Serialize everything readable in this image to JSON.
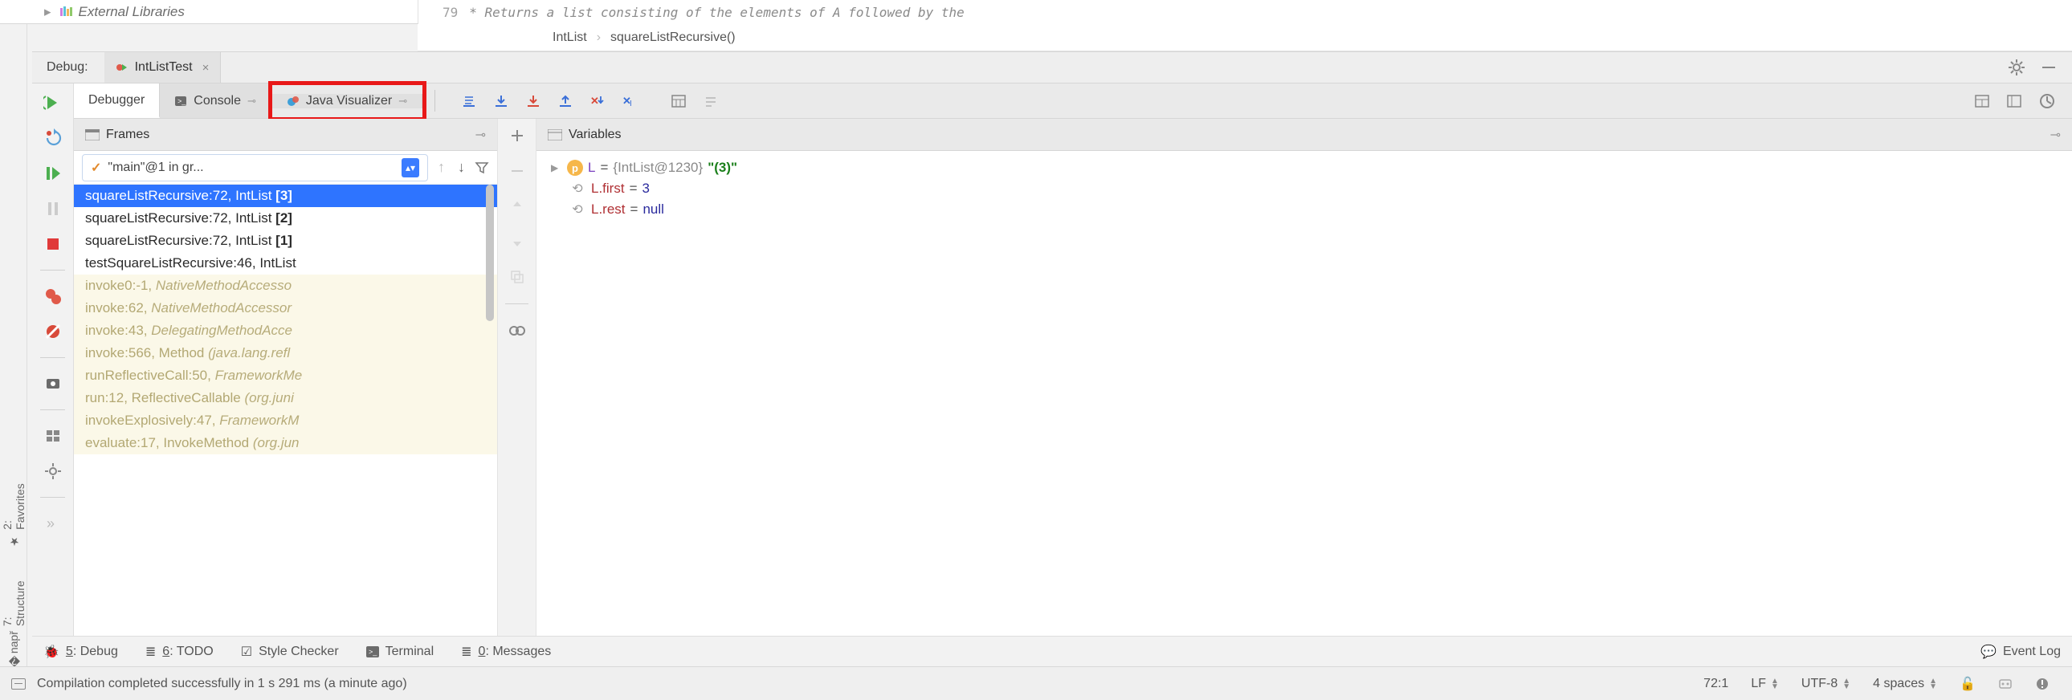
{
  "project": {
    "external_libs": "External Libraries"
  },
  "editor": {
    "line_no": "79",
    "comment": "* Returns a list consisting of the elements of A followed by the",
    "breadcrumb": [
      "IntList",
      "squareListRecursive()"
    ]
  },
  "debug": {
    "label": "Debug:",
    "run_config": "IntListTest",
    "tabs": {
      "debugger": "Debugger",
      "console": "Console",
      "java_vis": "Java Visualizer"
    }
  },
  "frames": {
    "title": "Frames",
    "thread": "\"main\"@1 in gr...",
    "stack": [
      {
        "text": "squareListRecursive:72, IntList ",
        "suffix": "[3]",
        "sel": true
      },
      {
        "text": "squareListRecursive:72, IntList ",
        "suffix": "[2]"
      },
      {
        "text": "squareListRecursive:72, IntList ",
        "suffix": "[1]"
      },
      {
        "text": "testSquareListRecursive:46, IntList",
        "suffix": ""
      },
      {
        "text": "invoke0:-1, ",
        "ital": "NativeMethodAccesso",
        "lib": true
      },
      {
        "text": "invoke:62, ",
        "ital": "NativeMethodAccessor",
        "lib": true
      },
      {
        "text": "invoke:43, ",
        "ital": "DelegatingMethodAcce",
        "lib": true
      },
      {
        "text": "invoke:566, Method ",
        "ital": "(java.lang.refl",
        "lib": true
      },
      {
        "text": "runReflectiveCall:50, ",
        "ital": "FrameworkMe",
        "lib": true
      },
      {
        "text": "run:12, ReflectiveCallable ",
        "ital": "(org.juni",
        "lib": true
      },
      {
        "text": "invokeExplosively:47, ",
        "ital": "FrameworkM",
        "lib": true
      },
      {
        "text": "evaluate:17, InvokeMethod ",
        "ital": "(org.jun",
        "lib": true
      }
    ]
  },
  "variables": {
    "title": "Variables",
    "root": {
      "name": "L",
      "type": "{IntList@1230}",
      "str": "\"(3)\""
    },
    "fields": [
      {
        "name": "L.first",
        "val": "3"
      },
      {
        "name": "L.rest",
        "val": "null"
      }
    ]
  },
  "bottom": {
    "debug": "5: Debug",
    "todo": "6: TODO",
    "style": "Style Checker",
    "terminal": "Terminal",
    "messages": "0: Messages",
    "eventlog": "Event Log"
  },
  "status": {
    "msg": "Compilation completed successfully in 1 s 291 ms (a minute ago)",
    "pos": "72:1",
    "le": "LF",
    "enc": "UTF-8",
    "indent": "4 spaces"
  },
  "sidebar": {
    "favorites": "2: Favorites",
    "structure": "7: Structure"
  }
}
